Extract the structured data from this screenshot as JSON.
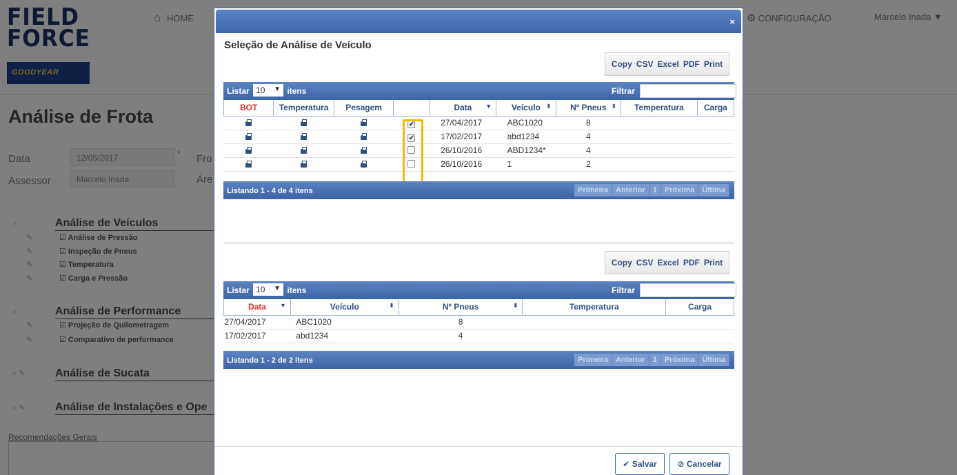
{
  "background": {
    "logo": {
      "line1": "FIELD",
      "line2": "FORCE",
      "brand": "GOODYEAR"
    },
    "nav": {
      "home": "HOME",
      "config": "CONFIGURAÇÃO",
      "user": "Marcelo Inada"
    },
    "title": "Análise de Frota",
    "form": {
      "data_label": "Data",
      "data_value": "12/05/2017",
      "assessor_label": "Assessor",
      "assessor_value": "Marcelo Inada",
      "frota_label_cut": "Fro",
      "area_label_cut": "Áre"
    },
    "sections": [
      {
        "title": "Análise de Veículos",
        "items": [
          "Análise de Pressão",
          "Inspeção de Pneus",
          "Temperatura",
          "Carga e Pressão"
        ]
      },
      {
        "title": "Análise de Performance",
        "items": [
          "Projeção de Quilometragem",
          "Comparativo de performance"
        ]
      },
      {
        "title": "Análise de Sucata",
        "items": []
      },
      {
        "title": "Análise de Instalações e Ope",
        "items": []
      }
    ],
    "recomendacoes": "Recomendações Gerais"
  },
  "modal": {
    "title": "Seleção de Análise de Veículo",
    "close": "×",
    "export_buttons": [
      "Copy",
      "CSV",
      "Excel",
      "PDF",
      "Print"
    ],
    "listar_prefix": "Listar",
    "listar_value": "10",
    "listar_suffix": "itens",
    "filtrar": "Filtrar",
    "pager": [
      "Primeira",
      "Anterior",
      "1",
      "Próxima",
      "Última"
    ],
    "table1": {
      "columns": [
        "BOT",
        "Temperatura",
        "Pesagem",
        "",
        "Data",
        "Veículo",
        "Nº Pneus",
        "Temperatura",
        "Carga"
      ],
      "rows": [
        {
          "checked": true,
          "data": "27/04/2017",
          "veiculo": "ABC1020",
          "pneus": "8"
        },
        {
          "checked": true,
          "data": "17/02/2017",
          "veiculo": "abd1234",
          "pneus": "4"
        },
        {
          "checked": false,
          "data": "26/10/2016",
          "veiculo": "ABD1234*",
          "pneus": "4"
        },
        {
          "checked": false,
          "data": "26/10/2016",
          "veiculo": "1",
          "pneus": "2"
        }
      ],
      "listing": "Listando 1 - 4 de 4 itens"
    },
    "table2": {
      "columns": [
        "Data",
        "Veículo",
        "Nº Pneus",
        "Temperatura",
        "Carga"
      ],
      "rows": [
        {
          "data": "27/04/2017",
          "veiculo": "ABC1020",
          "pneus": "8"
        },
        {
          "data": "17/02/2017",
          "veiculo": "abd1234",
          "pneus": "4"
        }
      ],
      "listing": "Listando 1 - 2 de 2 itens"
    },
    "salvar": "Salvar",
    "cancelar": "Cancelar"
  },
  "colors": {
    "header_blue": "#3e65a8",
    "highlight": "#f5b800",
    "sort_red": "#d9312b"
  }
}
